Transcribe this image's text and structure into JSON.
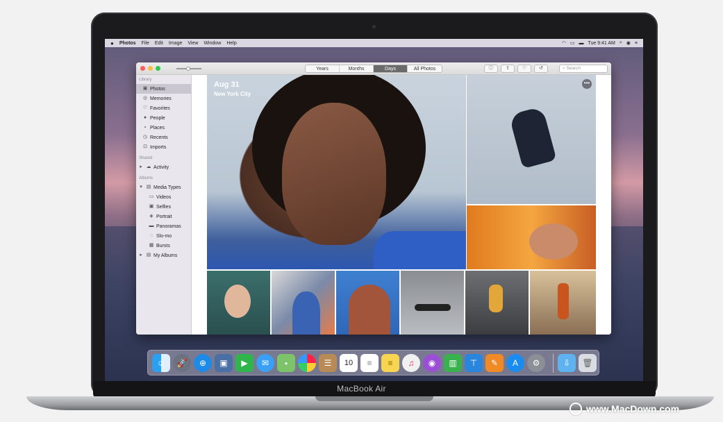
{
  "device": {
    "model_label": "MacBook Air"
  },
  "menubar": {
    "apple": "",
    "app_name": "Photos",
    "menus": [
      "File",
      "Edit",
      "Image",
      "View",
      "Window",
      "Help"
    ],
    "clock": "Tue 9:41 AM"
  },
  "toolbar": {
    "tabs": [
      "Years",
      "Months",
      "Days",
      "All Photos"
    ],
    "selected_tab": "Days",
    "buttons": [
      "info-icon",
      "share-icon",
      "heart-icon",
      "rotate-icon"
    ],
    "search_placeholder": "Search"
  },
  "sidebar": {
    "sections": [
      {
        "header": "Library",
        "items": [
          {
            "label": "Photos",
            "icon": "photos-icon",
            "selected": true
          },
          {
            "label": "Memories",
            "icon": "memories-icon"
          },
          {
            "label": "Favorites",
            "icon": "heart-icon"
          },
          {
            "label": "People",
            "icon": "person-icon"
          },
          {
            "label": "Places",
            "icon": "pin-icon"
          },
          {
            "label": "Recents",
            "icon": "clock-icon"
          },
          {
            "label": "Imports",
            "icon": "import-icon"
          }
        ]
      },
      {
        "header": "Shared",
        "items": [
          {
            "label": "Activity",
            "icon": "cloud-icon",
            "disclosure": true
          }
        ]
      },
      {
        "header": "Albums",
        "items": [
          {
            "label": "Media Types",
            "icon": "folder-icon",
            "disclosure": true,
            "expanded": true
          },
          {
            "label": "Videos",
            "icon": "video-icon",
            "child": true
          },
          {
            "label": "Selfies",
            "icon": "selfie-icon",
            "child": true
          },
          {
            "label": "Portrait",
            "icon": "portrait-icon",
            "child": true
          },
          {
            "label": "Panoramas",
            "icon": "panorama-icon",
            "child": true
          },
          {
            "label": "Slo-mo",
            "icon": "slomo-icon",
            "child": true
          },
          {
            "label": "Bursts",
            "icon": "burst-icon",
            "child": true
          },
          {
            "label": "My Albums",
            "icon": "folder-icon",
            "disclosure": true
          }
        ]
      }
    ]
  },
  "content": {
    "date": "Aug 31",
    "place": "New York City"
  },
  "dock": {
    "apps": [
      "Finder",
      "Launchpad",
      "Safari",
      "Photo Booth",
      "FaceTime",
      "Messages",
      "Maps",
      "Photos",
      "Contacts",
      "Calendar",
      "Reminders",
      "Notes",
      "Music",
      "Podcasts",
      "Numbers",
      "Keynote",
      "Pages",
      "App Store",
      "System Preferences",
      "Downloads",
      "Trash"
    ],
    "calendar_day": "10"
  },
  "watermark": {
    "text": "www.MacDown.com"
  },
  "colors": {
    "accent": "#2f5fc4",
    "window_bg": "#ffffff",
    "sidebar_bg": "#e9e6ee"
  }
}
